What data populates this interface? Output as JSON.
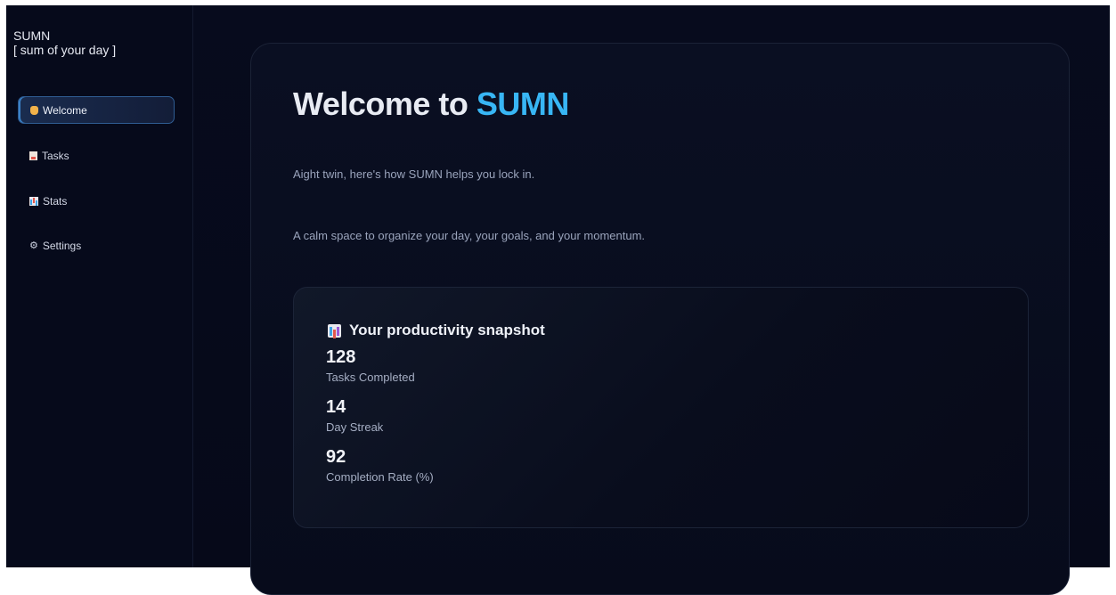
{
  "brand": {
    "title": "SUMN",
    "subtitle": "[ sum of your day ]"
  },
  "sidebar": {
    "items": [
      {
        "label": "Welcome",
        "icon": "waving-hand-icon",
        "active": true
      },
      {
        "label": "Tasks",
        "icon": "memo-icon",
        "active": false
      },
      {
        "label": "Stats",
        "icon": "bar-chart-icon",
        "active": false
      },
      {
        "label": "Settings",
        "icon": "gear-icon",
        "active": false,
        "glyph": "⚙"
      }
    ]
  },
  "main": {
    "heading_prefix": "Welcome to",
    "heading_accent": "SUMN",
    "intro": "Aight twin, here's how SUMN helps you lock in.",
    "tagline": "A calm space to organize your day, your goals, and your momentum."
  },
  "snapshot": {
    "title": "Your productivity snapshot",
    "icon": "bar-chart-icon",
    "stats": [
      {
        "value": "128",
        "label": "Tasks Completed"
      },
      {
        "value": "14",
        "label": "Day Streak"
      },
      {
        "value": "92",
        "label": "Completion Rate (%)"
      }
    ]
  },
  "colors": {
    "background": "#05081a",
    "accent": "#38b6f5",
    "active_border": "#2f5d93",
    "text_primary": "#e8ebf3",
    "text_muted": "#9aa4bc"
  }
}
